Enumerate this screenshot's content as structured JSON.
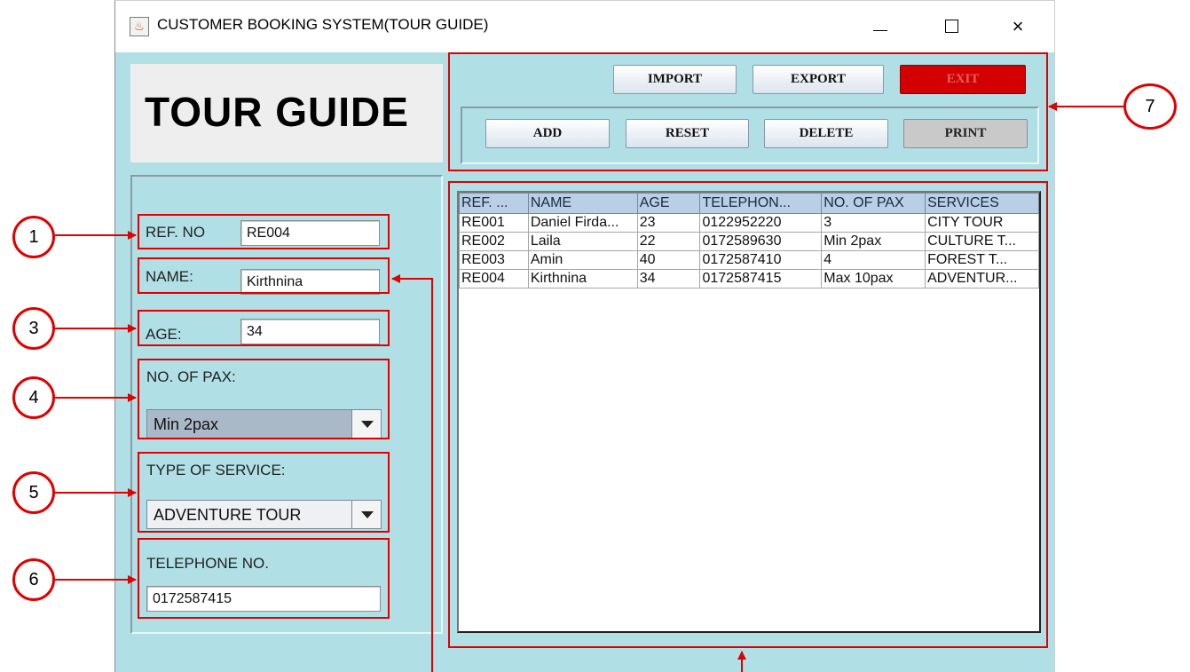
{
  "window": {
    "title": "CUSTOMER BOOKING SYSTEM(TOUR GUIDE)",
    "app_icon_glyph": "♨"
  },
  "window_controls": {
    "minimize": "minimize-icon",
    "maximize": "maximize-icon",
    "close": "×"
  },
  "logo": {
    "text": "TOUR GUIDE"
  },
  "form": {
    "ref_no": {
      "label": "REF. NO",
      "value": "RE004"
    },
    "name": {
      "label": "NAME:",
      "value": "Kirthnina"
    },
    "age": {
      "label": "AGE:",
      "value": "34"
    },
    "pax": {
      "label": "NO. OF PAX:",
      "selected": "Min 2pax"
    },
    "service": {
      "label": "TYPE OF SERVICE:",
      "selected": "ADVENTURE TOUR"
    },
    "telephone": {
      "label": "TELEPHONE NO.",
      "value": "0172587415"
    }
  },
  "toolbar": {
    "import_label": "IMPORT",
    "export_label": "EXPORT",
    "exit_label": "EXIT",
    "add_label": "ADD",
    "reset_label": "RESET",
    "delete_label": "DELETE",
    "print_label": "PRINT"
  },
  "table": {
    "columns": [
      "REF. ...",
      "NAME",
      "AGE",
      "TELEPHON...",
      "NO. OF PAX",
      "SERVICES"
    ],
    "rows": [
      [
        "RE001",
        "Daniel Firda...",
        "23",
        "0122952220",
        "3",
        "CITY TOUR"
      ],
      [
        "RE002",
        "Laila",
        "22",
        "0172589630",
        "Min 2pax",
        "CULTURE T..."
      ],
      [
        "RE003",
        "Amin",
        "40",
        "0172587410",
        "4",
        "FOREST T..."
      ],
      [
        "RE004",
        "Kirthnina",
        "34",
        "0172587415",
        "Max 10pax",
        "ADVENTUR..."
      ]
    ]
  },
  "annotations": [
    "1",
    "3",
    "4",
    "5",
    "6",
    "7"
  ],
  "colors": {
    "window_bg": "#b0e0e6",
    "annotation_red": "#e00000",
    "exit_button": "#d40000",
    "table_header": "#b8cfe5"
  }
}
